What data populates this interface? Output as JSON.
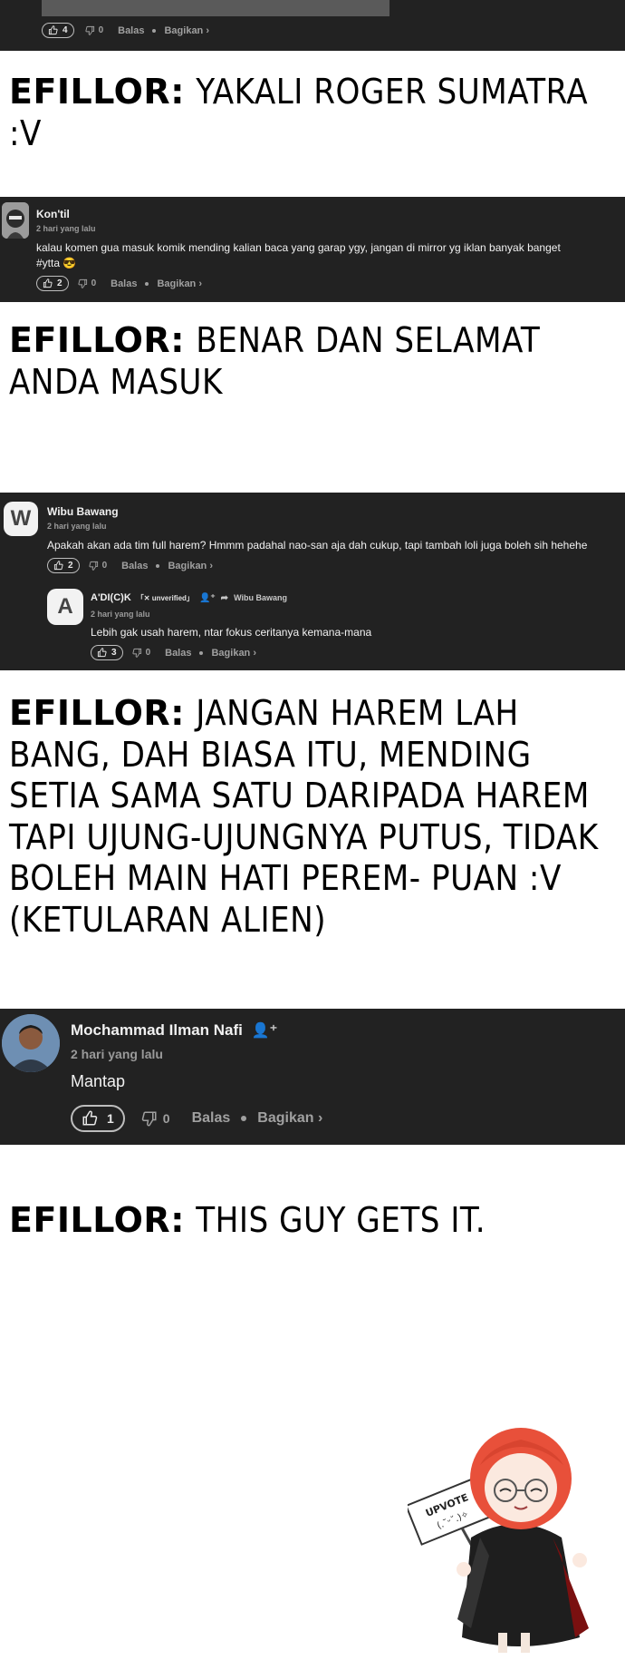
{
  "top_comment": {
    "likes": "4",
    "dislikes": "0",
    "reply": "Balas",
    "share": "Bagikan ›"
  },
  "notes": [
    {
      "who": "EFILLOR:",
      "text": "YAKALI ROGER SUMATRA :V"
    },
    {
      "who": "EFILLOR:",
      "text": "BENAR DAN SELAMAT ANDA MASUK"
    },
    {
      "who": "EFILLOR:",
      "text": "JANGAN HAREM LAH BANG, DAH BIASA ITU, MENDING SETIA SAMA SATU DARIPADA HAREM TAPI UJUNG-UJUNGNYA PUTUS, TIDAK BOLEH MAIN HATI PEREM- PUAN :V (KETULARAN ALIEN)"
    },
    {
      "who": "EFILLOR:",
      "text": "THIS GUY GETS IT."
    }
  ],
  "comment1": {
    "name": "Kon'til",
    "time": "2 hari yang lalu",
    "text1": "kalau komen gua masuk komik mending kalian baca yang garap ygy, jangan di mirror yg iklan banyak banget",
    "text2": "#ytta 😎",
    "likes": "2",
    "dislikes": "0",
    "reply": "Balas",
    "share": "Bagikan ›"
  },
  "comment2": {
    "avatar_letter": "W",
    "name": "Wibu Bawang",
    "time": "2 hari yang lalu",
    "text": "Apakah akan ada tim full harem? Hmmm padahal nao-san aja dah cukup, tapi tambah loli juga boleh sih hehehe",
    "likes": "2",
    "dislikes": "0",
    "reply": "Balas",
    "share": "Bagikan ›",
    "reply_comment": {
      "avatar_letter": "A",
      "name": "A'DI(C)K",
      "badge": "「✕ unverified」",
      "reply_to": "Wibu Bawang",
      "time": "2 hari yang lalu",
      "text": "Lebih gak usah harem, ntar fokus ceritanya kemana-mana",
      "likes": "3",
      "dislikes": "0",
      "reply": "Balas",
      "share": "Bagikan ›"
    }
  },
  "comment3": {
    "name": "Mochammad Ilman Nafi",
    "time": "2 hari yang lalu",
    "text": "Mantap",
    "likes": "1",
    "dislikes": "0",
    "reply": "Balas",
    "share": "Bagikan ›"
  },
  "mascot": {
    "sign_line1": "UPVOTE",
    "sign_line2": "(.˘ᵕ˘.)✧"
  },
  "colors": {
    "panel_bg": "#222222",
    "text_light": "#f1f1f1",
    "muted": "#a0a0a0",
    "mascot_hair": "#e8503a"
  }
}
